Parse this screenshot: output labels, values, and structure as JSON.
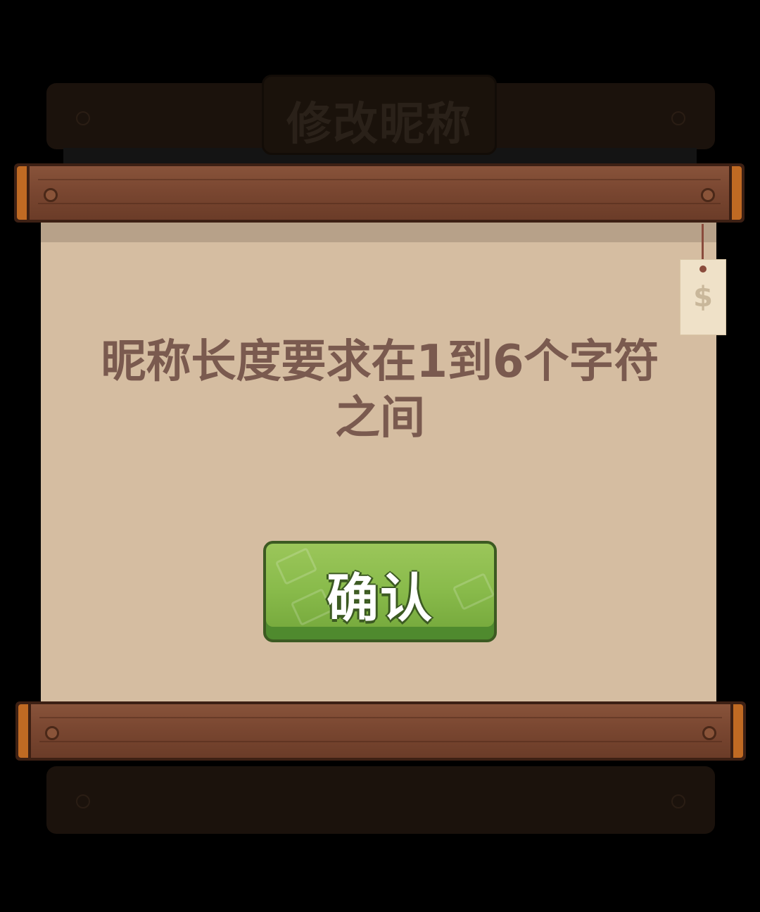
{
  "background_dialog": {
    "title": "修改昵称"
  },
  "dialog": {
    "message": "昵称长度要求在1到6个字符之间",
    "confirm_label": "确认",
    "tag_glyph": "$"
  },
  "colors": {
    "paper": "#d5bda1",
    "plank": "#7a4731",
    "button_green": "#89bb4b",
    "message_text": "#7a5a4f"
  }
}
